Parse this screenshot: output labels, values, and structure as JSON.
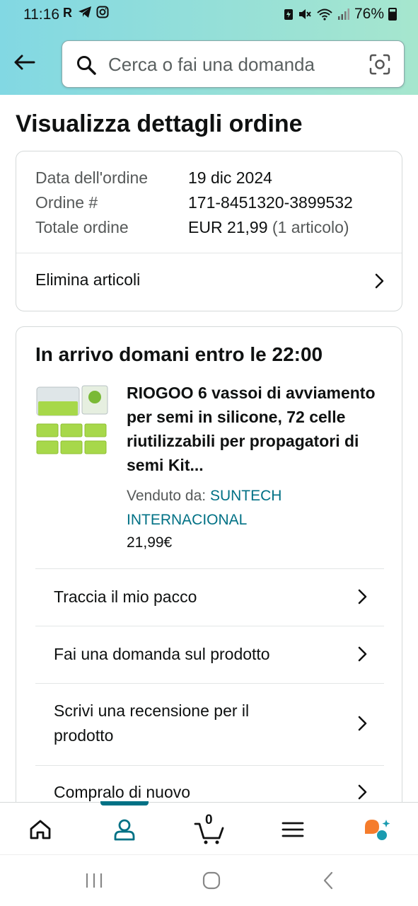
{
  "status_bar": {
    "time": "11:16",
    "battery": "76%"
  },
  "search": {
    "placeholder": "Cerca o fai una domanda"
  },
  "page_title": "Visualizza dettagli ordine",
  "order_summary": {
    "rows": [
      {
        "label": "Data dell'ordine",
        "value": "19 dic 2024"
      },
      {
        "label": "Ordine #",
        "value": "171-8451320-3899532"
      },
      {
        "label": "Totale ordine",
        "value": "EUR 21,99",
        "value_extra": "(1 articolo)"
      }
    ],
    "delete_items": "Elimina articoli"
  },
  "shipment": {
    "arrival": "In arrivo domani entro le 22:00",
    "product_title": "RIOGOO 6 vassoi di avviamento per semi in silicone, 72 celle riutilizzabili per propagatori di semi Kit...",
    "seller_label": "Venduto da:",
    "seller_name": "SUNTECH INTERNACIONAL",
    "price": "21,99€",
    "actions": [
      "Traccia il mio pacco",
      "Fai una domanda sul prodotto",
      "Scrivi una recensione per il prodotto",
      "Compralo di nuovo"
    ]
  },
  "bottom_nav": {
    "cart_count": "0",
    "active": "account"
  },
  "colors": {
    "header_gradient_start": "#82d8e3",
    "header_gradient_end": "#a6e6ce",
    "link": "#007185",
    "nav_active": "#007185",
    "rufus_orange": "#f57c2c",
    "rufus_teal": "#1a9bb0"
  }
}
